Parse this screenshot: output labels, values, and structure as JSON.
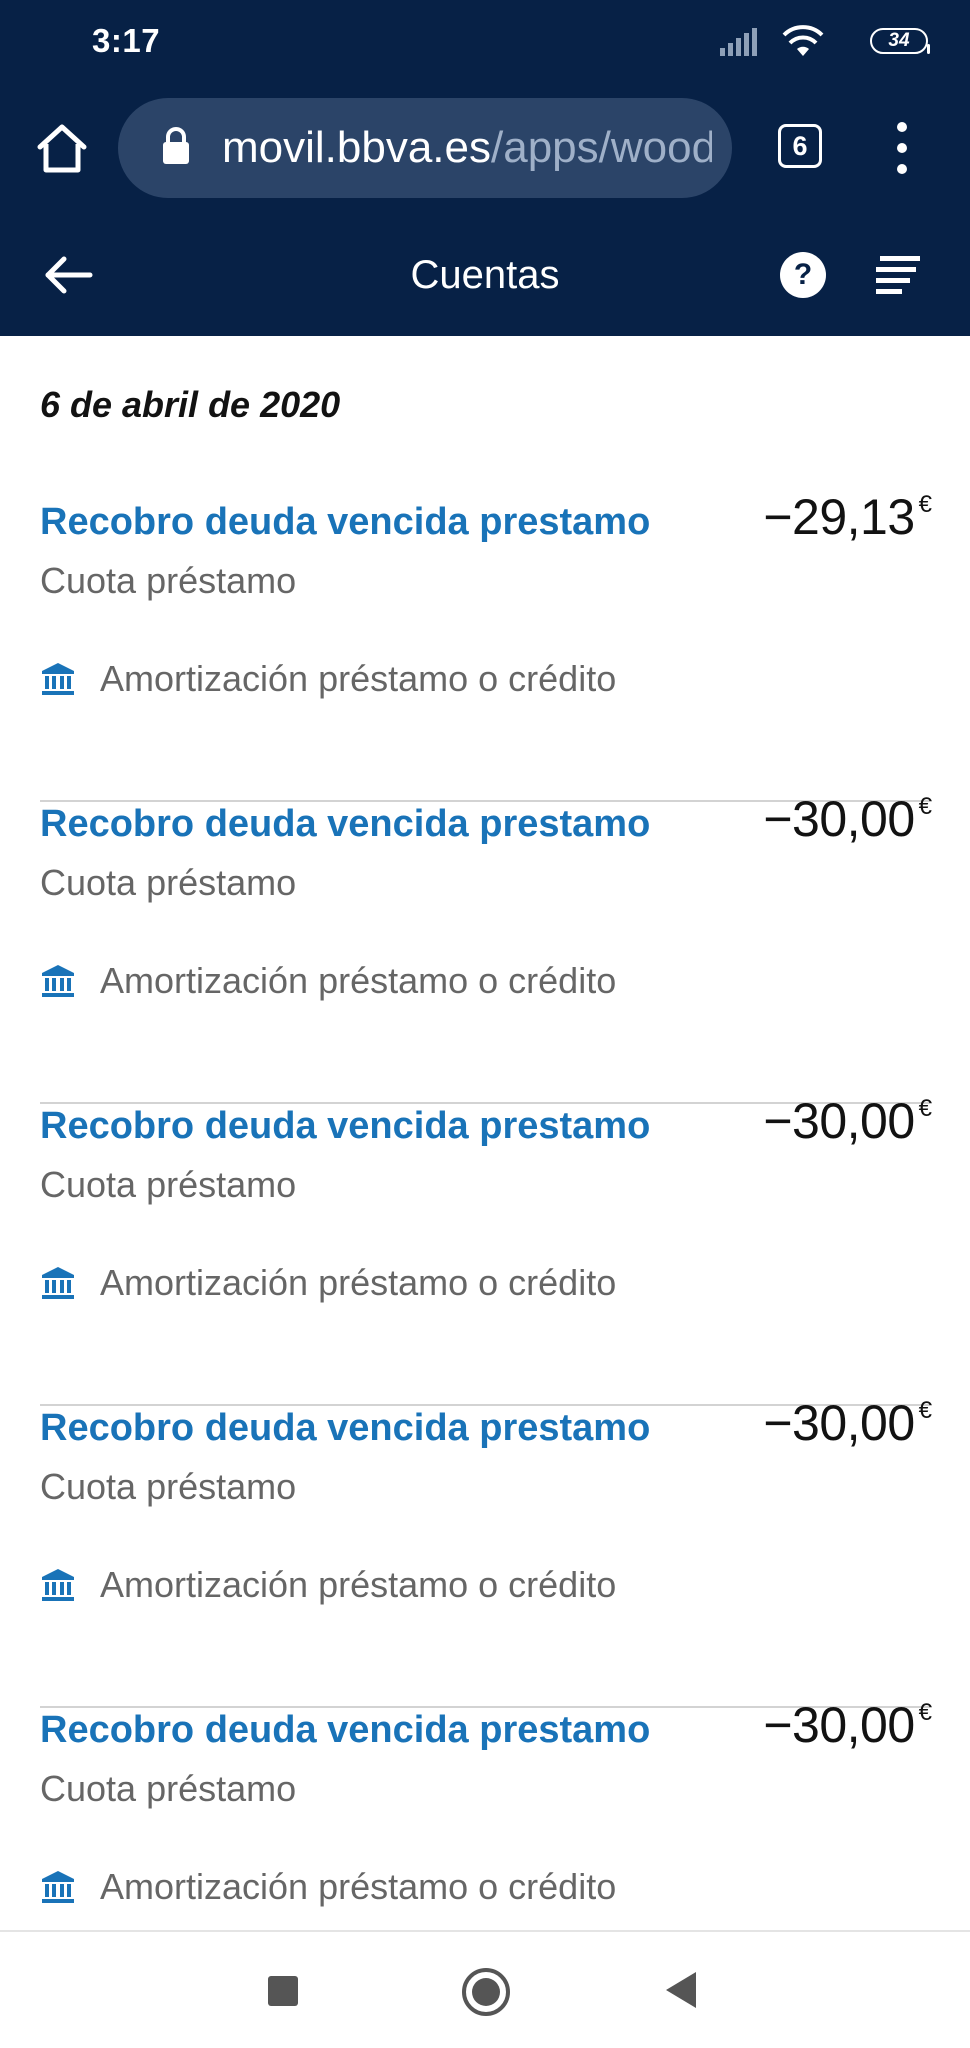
{
  "status_bar": {
    "time": "3:17",
    "battery": "34",
    "icons": [
      "signal-icon",
      "wifi-icon",
      "battery-icon"
    ]
  },
  "browser": {
    "url_domain": "movil.bbva.es",
    "url_path": "/apps/woody",
    "tab_count": "6",
    "icons": [
      "home-icon",
      "lock-icon",
      "tabs-icon",
      "more-vert-icon"
    ]
  },
  "header": {
    "title": "Cuentas",
    "icons": [
      "back-arrow-icon",
      "help-icon",
      "filter-list-icon"
    ],
    "help_label": "?"
  },
  "colors": {
    "brand_navy": "#072146",
    "link_blue": "#1973b8",
    "secondary_text": "#666666",
    "divider": "#d3d3d3"
  },
  "content": {
    "date": "6 de abril de 2020",
    "transactions": [
      {
        "title": "Recobro deuda vencida prestamo",
        "subtitle": "Cuota préstamo",
        "category": "Amortización préstamo o crédito",
        "amount": "−29,13",
        "currency": "€"
      },
      {
        "title": "Recobro deuda vencida prestamo",
        "subtitle": "Cuota préstamo",
        "category": "Amortización préstamo o crédito",
        "amount": "−30,00",
        "currency": "€"
      },
      {
        "title": "Recobro deuda vencida prestamo",
        "subtitle": "Cuota préstamo",
        "category": "Amortización préstamo o crédito",
        "amount": "−30,00",
        "currency": "€"
      },
      {
        "title": "Recobro deuda vencida prestamo",
        "subtitle": "Cuota préstamo",
        "category": "Amortización préstamo o crédito",
        "amount": "−30,00",
        "currency": "€"
      },
      {
        "title": "Recobro deuda vencida prestamo",
        "subtitle": "Cuota préstamo",
        "category": "Amortización préstamo o crédito",
        "amount": "−30,00",
        "currency": "€"
      }
    ]
  },
  "nav_bar": {
    "icons": [
      "recents-icon",
      "home-circle-icon",
      "back-triangle-icon"
    ]
  }
}
